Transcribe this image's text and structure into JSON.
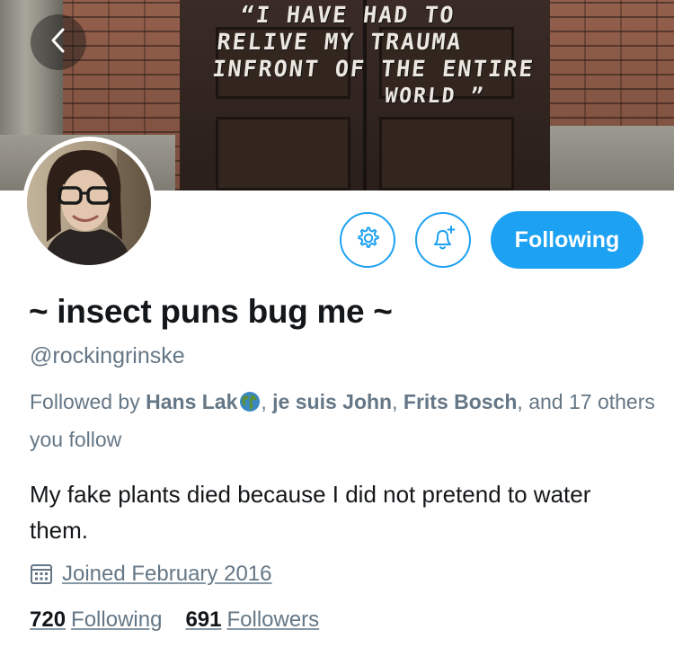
{
  "banner": {
    "graffiti_lines": [
      "“I HAVE HAD TO",
      "RELIVE MY TRAUMA",
      "INFRONT OF THE ENTIRE",
      "WORLD ”"
    ]
  },
  "nav": {
    "back_icon": "chevron-left-icon"
  },
  "actions": {
    "settings_icon": "gear-icon",
    "notify_icon": "bell-plus-icon",
    "following_label": "Following",
    "accent_color": "#1da1f2"
  },
  "profile": {
    "display_name": "~ insect puns bug me ~",
    "handle": "@rockingrinske",
    "followed_by": {
      "prefix": "Followed by ",
      "name1": "Hans Lak",
      "sep1": ", ",
      "name2": "je suis John",
      "sep2": ", ",
      "name3": "Frits Bosch",
      "suffix": ", and 17 others you follow"
    },
    "bio": "My fake plants died because I did not pretend to water them.",
    "joined": "Joined February 2016",
    "joined_icon": "calendar-icon",
    "stats": {
      "following_count": "720",
      "following_label": "Following",
      "followers_count": "691",
      "followers_label": "Followers"
    }
  }
}
